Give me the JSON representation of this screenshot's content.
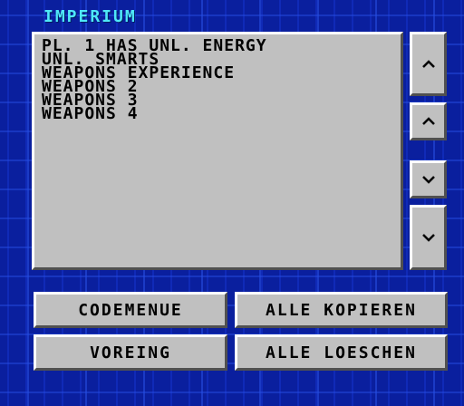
{
  "window": {
    "title": "IMPERIUM"
  },
  "list": {
    "items": [
      "PL. 1 HAS UNL. ENERGY",
      "UNL. SMARTS",
      "WEAPONS EXPERIENCE",
      "WEAPONS 2",
      "WEAPONS 3",
      "WEAPONS 4"
    ]
  },
  "scroll": {
    "top_icon": "chevron-up-icon",
    "up_icon": "chevron-up-icon",
    "down_icon": "chevron-down-icon",
    "bottom_icon": "chevron-down-icon"
  },
  "buttons": {
    "codemenue": "CODEMENUE",
    "kopieren": "ALLE KOPIEREN",
    "voreing": "VOREING",
    "loeschen": "ALLE LOESCHEN"
  },
  "colors": {
    "background": "#0a1f9e",
    "title": "#4fe8f8",
    "panel": "#c0c0c0"
  }
}
